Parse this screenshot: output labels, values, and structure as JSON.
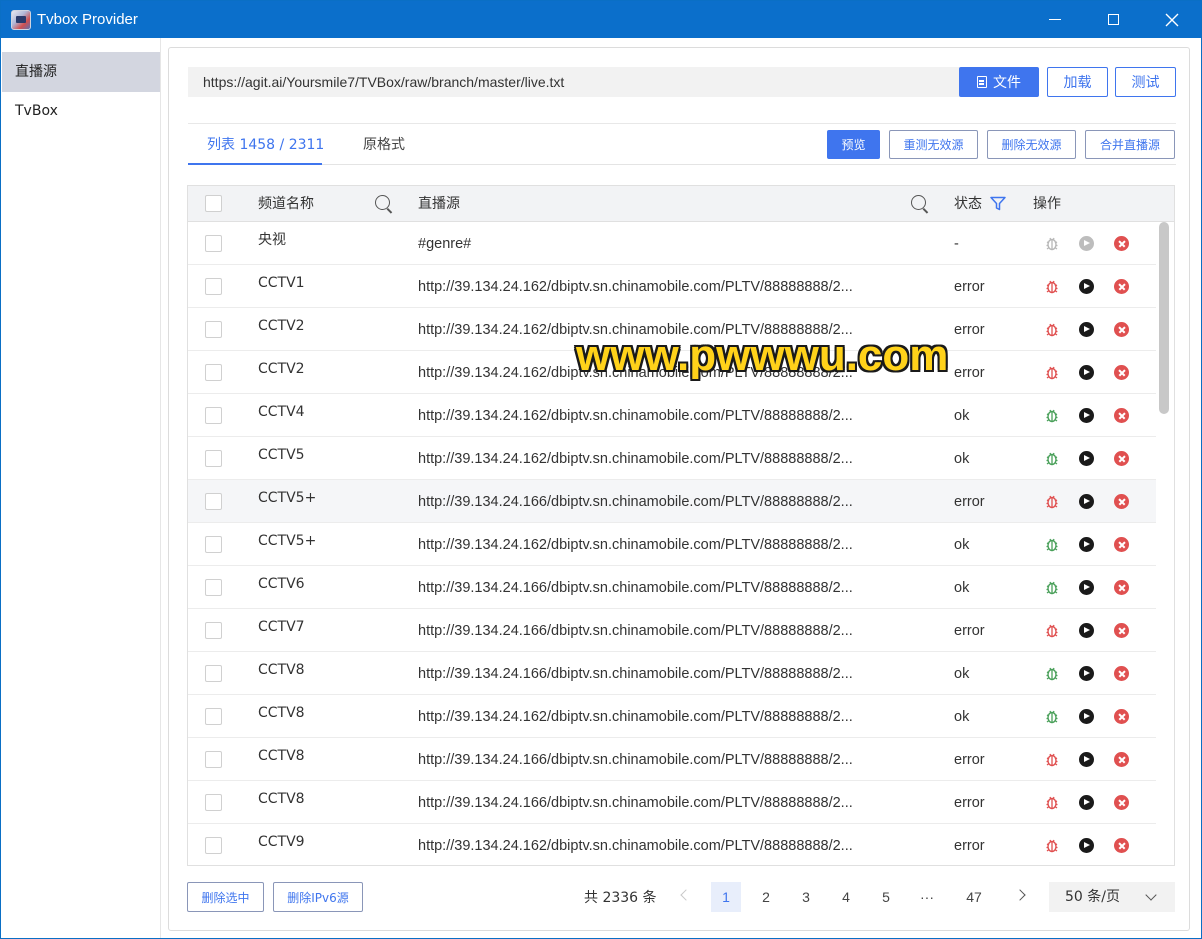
{
  "window": {
    "title": "Tvbox Provider"
  },
  "sidebar": {
    "items": [
      {
        "label": "直播源",
        "active": true
      },
      {
        "label": "TvBox",
        "active": false
      }
    ]
  },
  "toolbar": {
    "url": "https://agit.ai/Yoursmile7/TVBox/raw/branch/master/live.txt",
    "file_label": "文件",
    "load_label": "加载",
    "test_label": "测试"
  },
  "tabs": {
    "list_label": "列表 1458 / 2311",
    "raw_label": "原格式"
  },
  "actions": {
    "preview_label": "预览",
    "retest_label": "重测无效源",
    "delete_invalid_label": "删除无效源",
    "merge_label": "合并直播源"
  },
  "table": {
    "headers": {
      "name": "频道名称",
      "source": "直播源",
      "status": "状态",
      "ops": "操作"
    },
    "rows": [
      {
        "name": "央视",
        "url": "#genre#",
        "status": "-",
        "bug": "gray",
        "play": "disabled"
      },
      {
        "name": "CCTV1",
        "url": "http://39.134.24.162/dbiptv.sn.chinamobile.com/PLTV/88888888/2...",
        "status": "error",
        "bug": "red",
        "play": "on"
      },
      {
        "name": "CCTV2",
        "url": "http://39.134.24.162/dbiptv.sn.chinamobile.com/PLTV/88888888/2...",
        "status": "error",
        "bug": "red",
        "play": "on"
      },
      {
        "name": "CCTV2",
        "url": "http://39.134.24.162/dbiptv.sn.chinamobile.com/PLTV/88888888/2...",
        "status": "error",
        "bug": "red",
        "play": "on"
      },
      {
        "name": "CCTV4",
        "url": "http://39.134.24.162/dbiptv.sn.chinamobile.com/PLTV/88888888/2...",
        "status": "ok",
        "bug": "green",
        "play": "on"
      },
      {
        "name": "CCTV5",
        "url": "http://39.134.24.162/dbiptv.sn.chinamobile.com/PLTV/88888888/2...",
        "status": "ok",
        "bug": "green",
        "play": "on"
      },
      {
        "name": "CCTV5+",
        "url": "http://39.134.24.166/dbiptv.sn.chinamobile.com/PLTV/88888888/2...",
        "status": "error",
        "bug": "red",
        "play": "on",
        "hover": true
      },
      {
        "name": "CCTV5+",
        "url": "http://39.134.24.162/dbiptv.sn.chinamobile.com/PLTV/88888888/2...",
        "status": "ok",
        "bug": "green",
        "play": "on"
      },
      {
        "name": "CCTV6",
        "url": "http://39.134.24.166/dbiptv.sn.chinamobile.com/PLTV/88888888/2...",
        "status": "ok",
        "bug": "green",
        "play": "on"
      },
      {
        "name": "CCTV7",
        "url": "http://39.134.24.166/dbiptv.sn.chinamobile.com/PLTV/88888888/2...",
        "status": "error",
        "bug": "red",
        "play": "on"
      },
      {
        "name": "CCTV8",
        "url": "http://39.134.24.166/dbiptv.sn.chinamobile.com/PLTV/88888888/2...",
        "status": "ok",
        "bug": "green",
        "play": "on"
      },
      {
        "name": "CCTV8",
        "url": "http://39.134.24.162/dbiptv.sn.chinamobile.com/PLTV/88888888/2...",
        "status": "ok",
        "bug": "green",
        "play": "on"
      },
      {
        "name": "CCTV8",
        "url": "http://39.134.24.166/dbiptv.sn.chinamobile.com/PLTV/88888888/2...",
        "status": "error",
        "bug": "red",
        "play": "on"
      },
      {
        "name": "CCTV8",
        "url": "http://39.134.24.166/dbiptv.sn.chinamobile.com/PLTV/88888888/2...",
        "status": "error",
        "bug": "red",
        "play": "on"
      },
      {
        "name": "CCTV9",
        "url": "http://39.134.24.162/dbiptv.sn.chinamobile.com/PLTV/88888888/2...",
        "status": "error",
        "bug": "red",
        "play": "on"
      }
    ]
  },
  "footer": {
    "delete_selected_label": "删除选中",
    "delete_ipv6_label": "删除IPv6源",
    "total_label": "共 2336 条",
    "pages": [
      "1",
      "2",
      "3",
      "4",
      "5",
      "···",
      "47"
    ],
    "current_page": "1",
    "page_size_label": "50 条/页"
  },
  "watermark": {
    "text": "www.pwwwu.com"
  },
  "colors": {
    "accent": "#3f75ee",
    "titlebar": "#0b6fcb",
    "bug_red": "#e05050",
    "bug_green": "#4aa05a",
    "bug_gray": "#b8b8b8"
  }
}
